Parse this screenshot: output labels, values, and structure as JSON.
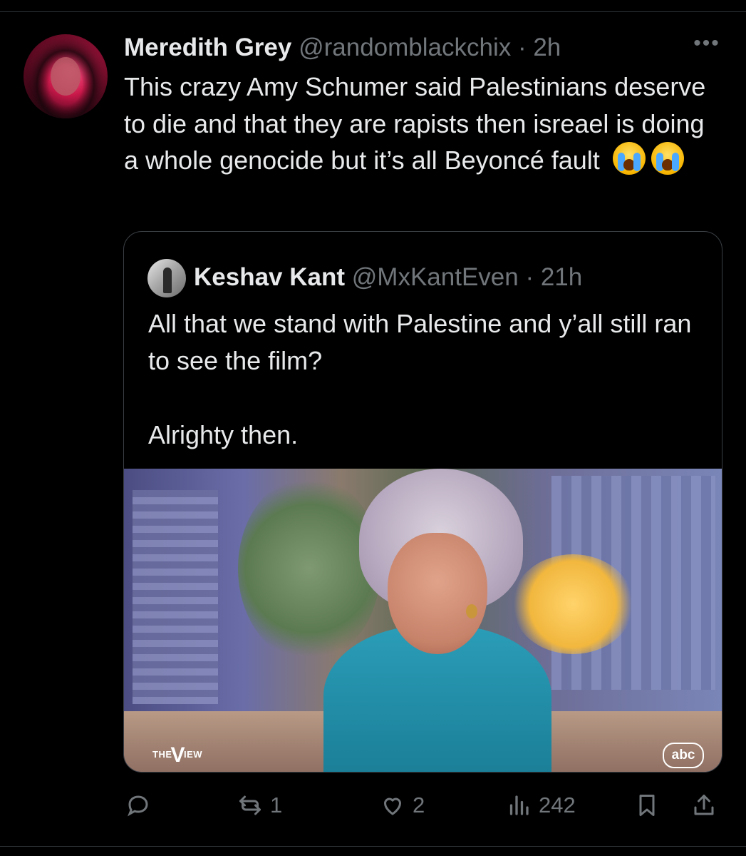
{
  "tweet": {
    "author_name": "Meredith Grey",
    "author_meta": "@randomblackchix · 2h",
    "text": "This crazy Amy Schumer said Palestinians deserve to die and that they are rapists then isreael is doing a whole genocide but it’s all Beyoncé fault",
    "emojis": [
      "loudly-crying-face",
      "loudly-crying-face"
    ]
  },
  "quote": {
    "author_name": "Keshav Kant",
    "author_meta": "@MxKantEven · 21h",
    "text_line1": "All that we stand with Palestine and y’all still ran to see the film?",
    "text_line2": "Alrighty then.",
    "media": {
      "logo_left": "THE VIEW",
      "logo_left_the": "THE",
      "logo_left_v": "V",
      "logo_left_iew": "IEW",
      "logo_right": "abc"
    }
  },
  "actions": {
    "reply": {
      "icon": "reply-icon",
      "count": ""
    },
    "retweet": {
      "icon": "retweet-icon",
      "count": "1"
    },
    "like": {
      "icon": "heart-icon",
      "count": "2"
    },
    "views": {
      "icon": "views-icon",
      "count": "242"
    },
    "bookmark": {
      "icon": "bookmark-icon"
    },
    "share": {
      "icon": "share-icon"
    }
  },
  "colors": {
    "background": "#000000",
    "text": "#e7e9ea",
    "secondary": "#71767b",
    "border": "#2f3336"
  }
}
